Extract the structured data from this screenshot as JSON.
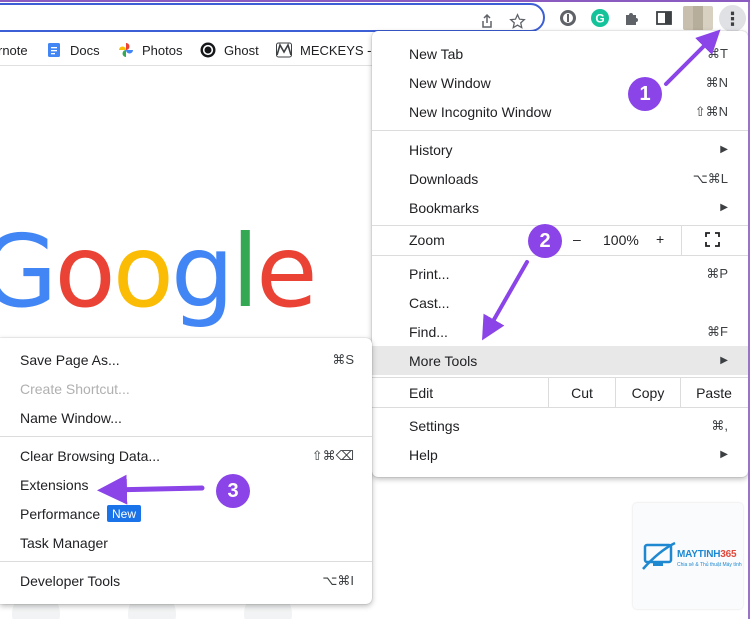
{
  "bookmarks": [
    {
      "label": "rnote",
      "icon": "evernote-icon"
    },
    {
      "label": "Docs",
      "icon": "docs-icon"
    },
    {
      "label": "Photos",
      "icon": "photos-icon"
    },
    {
      "label": "Ghost",
      "icon": "ghost-icon"
    },
    {
      "label": "MECKEYS -",
      "icon": "meckeys-icon"
    }
  ],
  "logo": "Google",
  "colors": {
    "accent": "#8a44e8",
    "omnibox_border": "#3c5fd6",
    "badge": "#1a73e8"
  },
  "main_menu": {
    "new_tab": {
      "label": "New Tab",
      "shortcut": "⌘T"
    },
    "new_window": {
      "label": "New Window",
      "shortcut": "⌘N"
    },
    "new_incognito": {
      "label": "New Incognito Window",
      "shortcut": "⇧⌘N"
    },
    "history": {
      "label": "History"
    },
    "downloads": {
      "label": "Downloads",
      "shortcut": "⌥⌘L"
    },
    "bookmarks": {
      "label": "Bookmarks"
    },
    "zoom": {
      "label": "Zoom",
      "minus": "–",
      "level": "100%",
      "plus": "+"
    },
    "print": {
      "label": "Print...",
      "shortcut": "⌘P"
    },
    "cast": {
      "label": "Cast..."
    },
    "find": {
      "label": "Find...",
      "shortcut": "⌘F"
    },
    "more_tools": {
      "label": "More Tools"
    },
    "edit": {
      "label": "Edit",
      "cut": "Cut",
      "copy": "Copy",
      "paste": "Paste"
    },
    "settings": {
      "label": "Settings",
      "shortcut": "⌘,"
    },
    "help": {
      "label": "Help"
    }
  },
  "sub_menu": {
    "save_page": {
      "label": "Save Page As...",
      "shortcut": "⌘S"
    },
    "create_shortcut": {
      "label": "Create Shortcut..."
    },
    "name_window": {
      "label": "Name Window..."
    },
    "clear_data": {
      "label": "Clear Browsing Data...",
      "shortcut": "⇧⌘⌫"
    },
    "extensions": {
      "label": "Extensions"
    },
    "performance": {
      "label": "Performance",
      "badge": "New"
    },
    "task_manager": {
      "label": "Task Manager"
    },
    "developer_tools": {
      "label": "Developer Tools",
      "shortcut": "⌥⌘I"
    }
  },
  "steps": [
    "1",
    "2",
    "3"
  ],
  "watermark": {
    "name_a": "MAYTINH",
    "name_b": "365",
    "sub": "Chia sẻ & Thủ thuật Máy tính"
  }
}
